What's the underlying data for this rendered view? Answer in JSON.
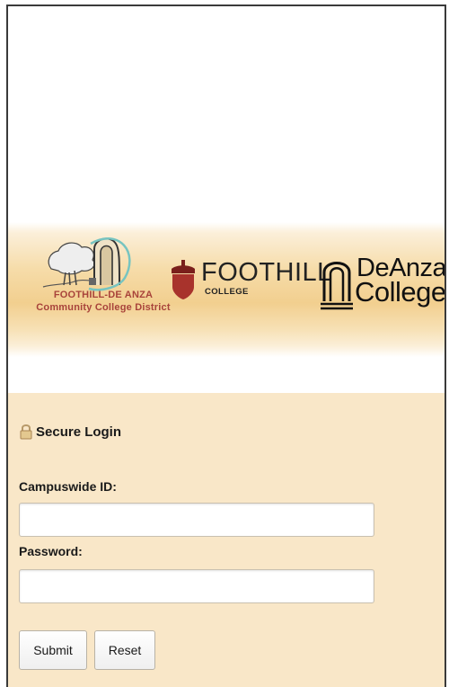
{
  "header": {
    "district_name_line1": "FOOTHILL-DE ANZA",
    "district_name_line2": "Community College District",
    "foothill_name": "FOOTHILL",
    "foothill_sub": "COLLEGE",
    "deanza_line1": "DeAnza",
    "deanza_line2": "College"
  },
  "login": {
    "secure_label": "Secure Login",
    "id_label": "Campuswide ID:",
    "id_value": "",
    "password_label": "Password:",
    "password_value": "",
    "submit_label": "Submit",
    "reset_label": "Reset"
  },
  "colors": {
    "band": "#f2cf8f",
    "login_bg": "#f9e7c8",
    "district_red": "#a8433a",
    "acorn_red": "#9e2f2a"
  }
}
